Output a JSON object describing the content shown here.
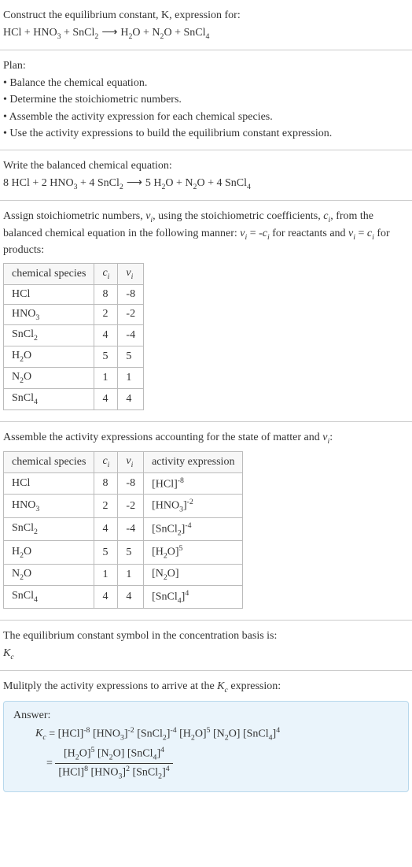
{
  "intro": {
    "l1": "Construct the equilibrium constant, K, expression for:",
    "eq": "HCl + HNO₃ + SnCl₂  ⟶  H₂O + N₂O + SnCl₄"
  },
  "plan": {
    "title": "Plan:",
    "b1": "• Balance the chemical equation.",
    "b2": "• Determine the stoichiometric numbers.",
    "b3": "• Assemble the activity expression for each chemical species.",
    "b4": "• Use the activity expressions to build the equilibrium constant expression."
  },
  "balanced": {
    "title": "Write the balanced chemical equation:",
    "eq": "8 HCl + 2 HNO₃ + 4 SnCl₂  ⟶  5 H₂O + N₂O + 4 SnCl₄"
  },
  "stoich_text": "Assign stoichiometric numbers, νᵢ, using the stoichiometric coefficients, cᵢ, from the balanced chemical equation in the following manner: νᵢ = -cᵢ for reactants and νᵢ = cᵢ for products:",
  "table1": {
    "h1": "chemical species",
    "h2": "cᵢ",
    "h3": "νᵢ",
    "rows": [
      {
        "s": "HCl",
        "c": "8",
        "v": "-8"
      },
      {
        "s": "HNO₃",
        "c": "2",
        "v": "-2"
      },
      {
        "s": "SnCl₂",
        "c": "4",
        "v": "-4"
      },
      {
        "s": "H₂O",
        "c": "5",
        "v": "5"
      },
      {
        "s": "N₂O",
        "c": "1",
        "v": "1"
      },
      {
        "s": "SnCl₄",
        "c": "4",
        "v": "4"
      }
    ]
  },
  "assemble_text": "Assemble the activity expressions accounting for the state of matter and νᵢ:",
  "table2": {
    "h1": "chemical species",
    "h2": "cᵢ",
    "h3": "νᵢ",
    "h4": "activity expression",
    "rows": [
      {
        "s": "HCl",
        "c": "8",
        "v": "-8",
        "a": "[HCl]⁻⁸"
      },
      {
        "s": "HNO₃",
        "c": "2",
        "v": "-2",
        "a": "[HNO₃]⁻²"
      },
      {
        "s": "SnCl₂",
        "c": "4",
        "v": "-4",
        "a": "[SnCl₂]⁻⁴"
      },
      {
        "s": "H₂O",
        "c": "5",
        "v": "5",
        "a": "[H₂O]⁵"
      },
      {
        "s": "N₂O",
        "c": "1",
        "v": "1",
        "a": "[N₂O]"
      },
      {
        "s": "SnCl₄",
        "c": "4",
        "v": "4",
        "a": "[SnCl₄]⁴"
      }
    ]
  },
  "kc_symbol": {
    "l1": "The equilibrium constant symbol in the concentration basis is:",
    "l2": "K_c"
  },
  "multiply": "Mulitply the activity expressions to arrive at the K_c expression:",
  "answer": {
    "label": "Answer:",
    "line1": "K_c = [HCl]⁻⁸ [HNO₃]⁻² [SnCl₂]⁻⁴ [H₂O]⁵ [N₂O] [SnCl₄]⁴",
    "frac_num": "[H₂O]⁵ [N₂O] [SnCl₄]⁴",
    "frac_den": "[HCl]⁸ [HNO₃]² [SnCl₂]⁴",
    "eq_prefix": "= "
  },
  "chart_data": {
    "type": "table",
    "tables": [
      {
        "columns": [
          "chemical species",
          "cᵢ",
          "νᵢ"
        ],
        "rows": [
          [
            "HCl",
            8,
            -8
          ],
          [
            "HNO₃",
            2,
            -2
          ],
          [
            "SnCl₂",
            4,
            -4
          ],
          [
            "H₂O",
            5,
            5
          ],
          [
            "N₂O",
            1,
            1
          ],
          [
            "SnCl₄",
            4,
            4
          ]
        ]
      },
      {
        "columns": [
          "chemical species",
          "cᵢ",
          "νᵢ",
          "activity expression"
        ],
        "rows": [
          [
            "HCl",
            8,
            -8,
            "[HCl]^-8"
          ],
          [
            "HNO₃",
            2,
            -2,
            "[HNO3]^-2"
          ],
          [
            "SnCl₂",
            4,
            -4,
            "[SnCl2]^-4"
          ],
          [
            "H₂O",
            5,
            5,
            "[H2O]^5"
          ],
          [
            "N₂O",
            1,
            1,
            "[N2O]"
          ],
          [
            "SnCl₄",
            4,
            4,
            "[SnCl4]^4"
          ]
        ]
      }
    ]
  }
}
